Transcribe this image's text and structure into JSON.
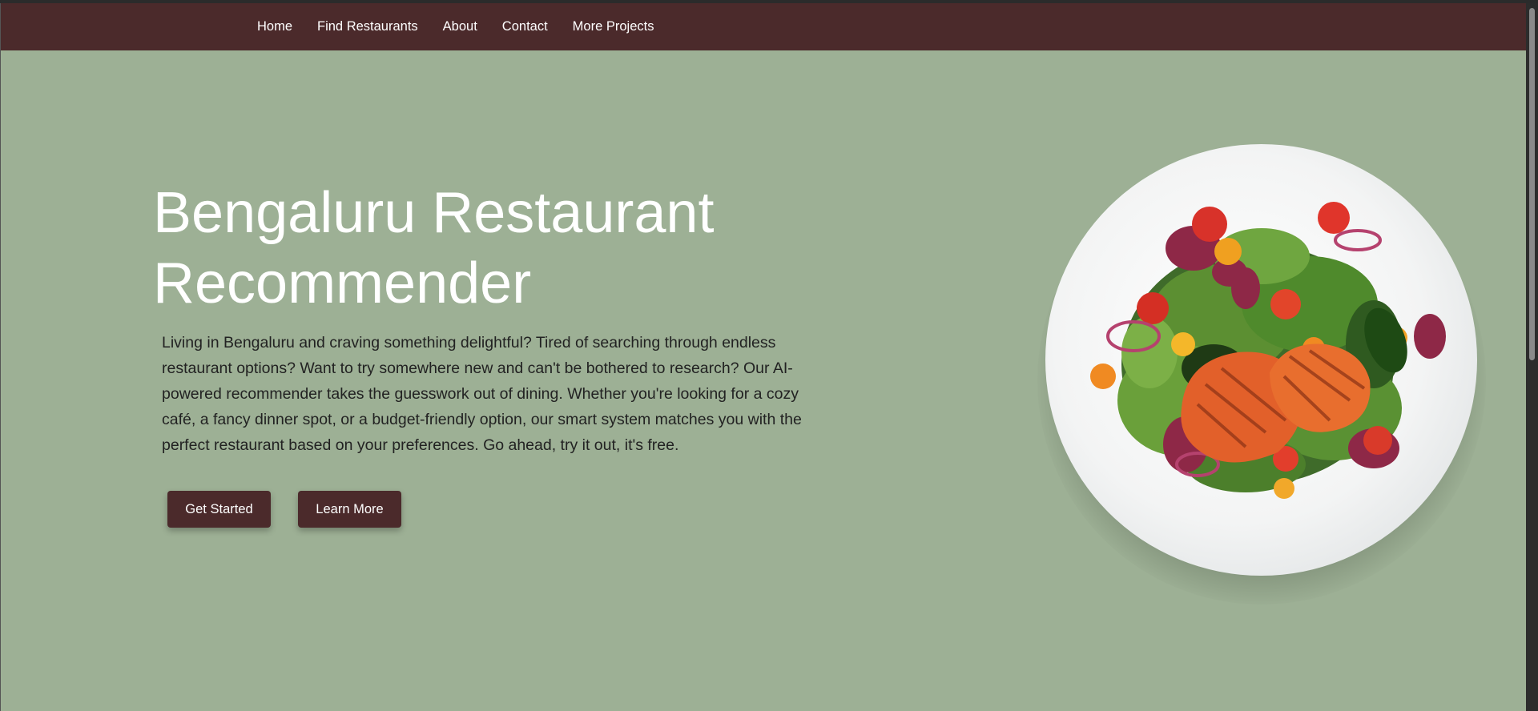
{
  "nav": {
    "items": [
      {
        "label": "Home"
      },
      {
        "label": "Find Restaurants"
      },
      {
        "label": "About"
      },
      {
        "label": "Contact"
      },
      {
        "label": "More Projects"
      }
    ]
  },
  "hero": {
    "title_line1": "Bengaluru Restaurant",
    "title_line2": "Recommender",
    "description": "Living in Bengaluru and craving something delightful? Tired of searching through endless restaurant options? Want to try somewhere new and can't be bothered to research? Our AI-powered recommender takes the guesswork out of dining. Whether you're looking for a cozy café, a fancy dinner spot, or a budget-friendly option, our smart system matches you with the perfect restaurant based on your preferences. Go ahead, try it out, it's free.",
    "primary_button": "Get Started",
    "secondary_button": "Learn More",
    "image_subject": "salmon-salad-plate"
  },
  "colors": {
    "navbar": "#4b2a2b",
    "background": "#9db095",
    "button": "#4b2a2b",
    "title_text": "#ffffff"
  }
}
